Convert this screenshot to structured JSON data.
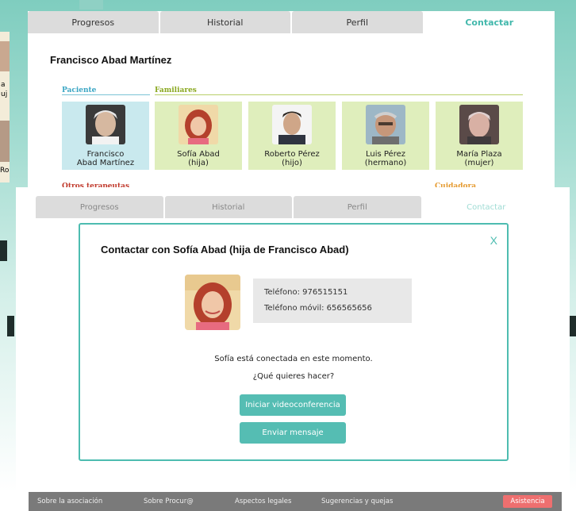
{
  "background_tabs": [
    {
      "label": "Progresos"
    },
    {
      "label": "Historial"
    },
    {
      "label": "Perfil"
    },
    {
      "label": "Contactar"
    }
  ],
  "patient": {
    "name": "Francisco Abad Martínez"
  },
  "sections": {
    "patient_label": "Paciente",
    "family_label": "Familiares",
    "therapists_label": "Otros terapeutas",
    "caregiver_label": "Cuidadora"
  },
  "patient_card": {
    "line1": "Francisco",
    "line2": "Abad Martínez"
  },
  "family_cards": [
    {
      "name": "Sofía Abad",
      "relation": "(hija)"
    },
    {
      "name": "Roberto Pérez",
      "relation": "(hijo)"
    },
    {
      "name": "Luis Pérez",
      "relation": "(hermano)"
    },
    {
      "name": "María Plaza",
      "relation": "(mujer)"
    }
  ],
  "left_partial": {
    "line1": "a",
    "line2": "uj",
    "line3": "Ro"
  },
  "front_tabs": [
    {
      "label": "Progresos"
    },
    {
      "label": "Historial"
    },
    {
      "label": "Perfil"
    },
    {
      "label": "Contactar"
    }
  ],
  "dialog": {
    "title": "Contactar con Sofía Abad (hija de Francisco Abad)",
    "close": "X",
    "phone": "Teléfono: 976515151",
    "mobile": "Teléfono móvil: 656565656",
    "status": "Sofía está conectada en este momento.",
    "question": "¿Qué quieres hacer?",
    "video_button": "Iniciar videoconferencia",
    "message_button": "Enviar mensaje"
  },
  "footer": {
    "about": "Sobre la asociación",
    "procura": "Sobre Procur@",
    "legal": "Aspectos legales",
    "suggestions": "Sugerencias y quejas",
    "assist": "Asistencia"
  },
  "colors": {
    "accent": "#4dbcb0",
    "patient_card": "#c9e9ee",
    "family_card": "#dfeebc",
    "assist": "#ee6f6f"
  }
}
